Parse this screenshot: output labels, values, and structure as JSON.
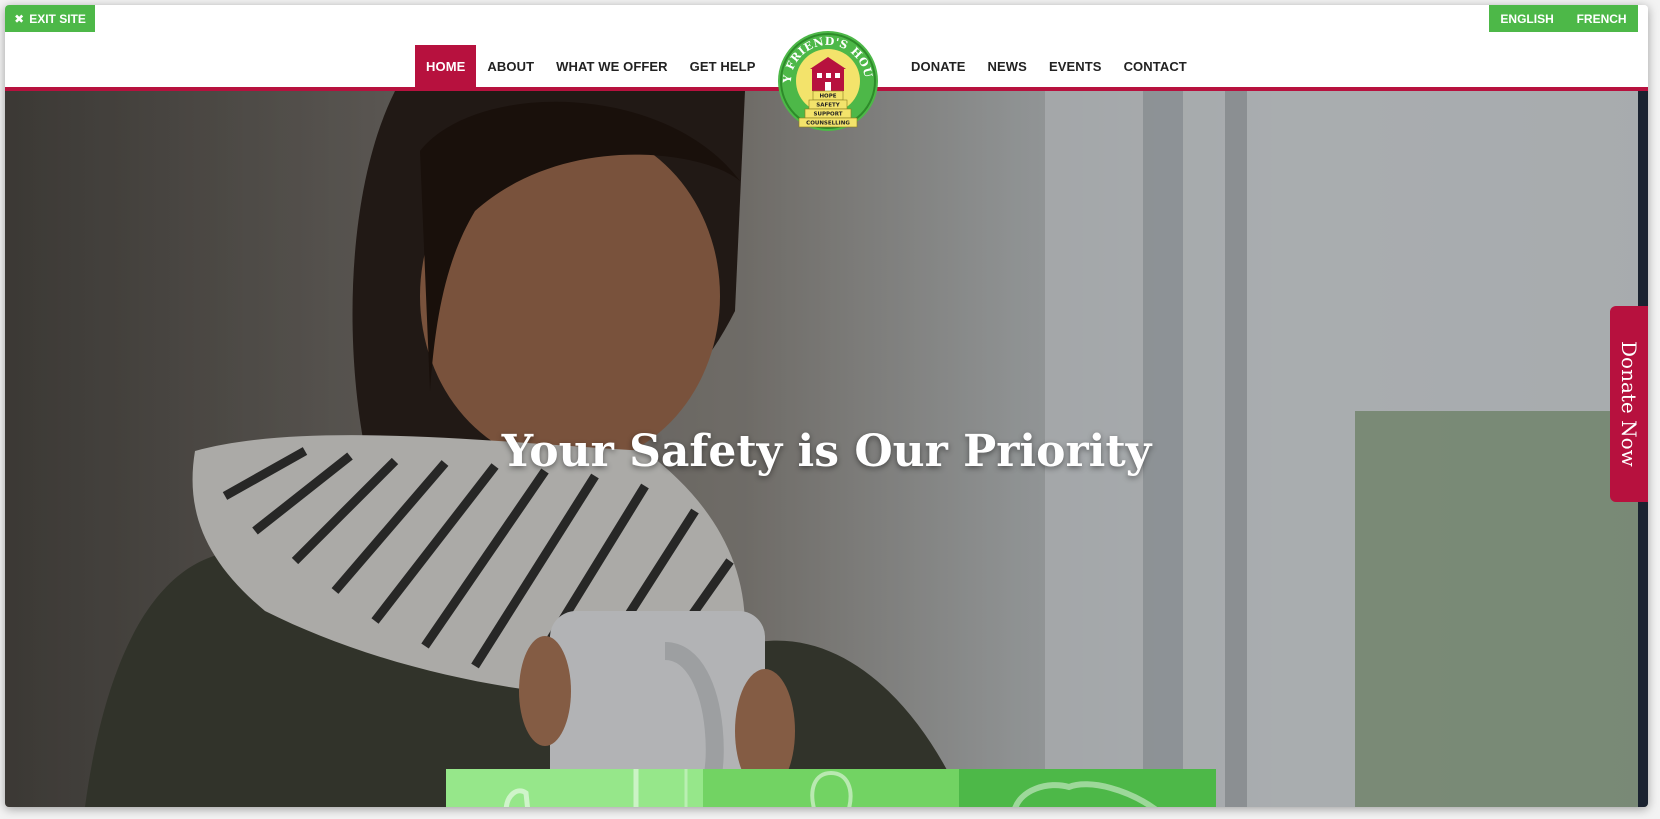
{
  "topbar": {
    "exit_label": "EXIT SITE",
    "languages": [
      "ENGLISH",
      "FRENCH"
    ]
  },
  "nav": {
    "left_items": [
      "HOME",
      "ABOUT",
      "WHAT WE OFFER",
      "GET HELP"
    ],
    "right_items": [
      "DONATE",
      "NEWS",
      "EVENTS",
      "CONTACT"
    ],
    "active": "HOME"
  },
  "logo": {
    "arc_text": "MY FRIEND'S HOUSE",
    "steps": [
      "HOPE",
      "SAFETY",
      "SUPPORT",
      "COUNSELLING"
    ]
  },
  "hero": {
    "title": "Your Safety is Our Priority"
  },
  "side_tab": {
    "label": "Donate Now"
  },
  "colors": {
    "brand_red": "#b7113e",
    "brand_green": "#4db848",
    "feature_light": "#96e78a",
    "feature_mid": "#72d363",
    "feature_dark": "#4db848"
  },
  "features": [
    {
      "icon": "hand-icon"
    },
    {
      "icon": "person-icon"
    },
    {
      "icon": "chat-icon"
    }
  ]
}
